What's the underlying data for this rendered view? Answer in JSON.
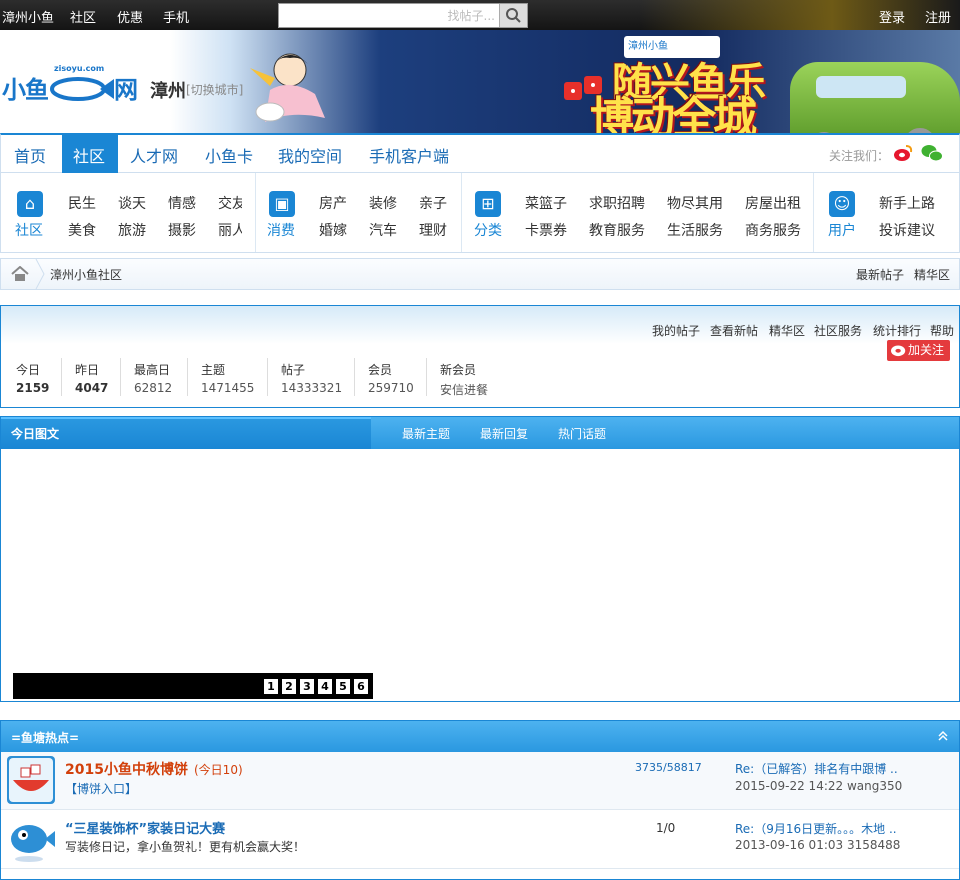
{
  "topbar": {
    "links": [
      "漳州小鱼",
      "社区",
      "优惠",
      "手机"
    ],
    "search_placeholder": "找帖子...",
    "login": "登录",
    "register": "注册"
  },
  "header": {
    "logo_text": "小鱼",
    "logo_suffix": "网",
    "logo_domain": "zisoyu.com",
    "city": "漳州",
    "switch_city": "[切换城市]",
    "promo_line1": "随兴鱼乐",
    "promo_line2": "博动全城",
    "banner_tag": "漳州小鱼"
  },
  "nav": {
    "items": [
      "首页",
      "社区",
      "人才网",
      "小鱼卡",
      "我的空间",
      "手机客户端"
    ],
    "active": "社区",
    "follow_label": "关注我们："
  },
  "categories": {
    "community": {
      "label": "社区",
      "row1": [
        "民生",
        "谈天",
        "情感",
        "交友"
      ],
      "row2": [
        "美食",
        "旅游",
        "摄影",
        "丽人"
      ]
    },
    "consume": {
      "label": "消费",
      "row1": [
        "房产",
        "装修",
        "亲子"
      ],
      "row2": [
        "婚嫁",
        "汽车",
        "理财"
      ]
    },
    "classify": {
      "label": "分类",
      "row1": [
        "菜篮子",
        "求职招聘",
        "物尽其用",
        "房屋出租"
      ],
      "row2": [
        "卡票券",
        "教育服务",
        "生活服务",
        "商务服务"
      ]
    },
    "user": {
      "label": "用户",
      "row1": [
        "新手上路"
      ],
      "row2": [
        "投诉建议"
      ]
    }
  },
  "breadcrumb": {
    "current": "漳州小鱼社区",
    "right_links": [
      "最新帖子",
      "精华区"
    ]
  },
  "stats": {
    "links": [
      "我的帖子",
      "查看新帖",
      "精华区",
      "社区服务",
      "统计排行",
      "帮助"
    ],
    "follow_btn": "加关注",
    "items": [
      {
        "label": "今日",
        "value": "2159"
      },
      {
        "label": "昨日",
        "value": "4047"
      },
      {
        "label": "最高日",
        "value": "62812"
      },
      {
        "label": "主题",
        "value": "1471455"
      },
      {
        "label": "帖子",
        "value": "14333321"
      },
      {
        "label": "会员",
        "value": "259710"
      },
      {
        "label": "新会员",
        "value": "安信进餐"
      }
    ]
  },
  "today_panel": {
    "title": "今日图文",
    "tabs": [
      "最新主题",
      "最新回复",
      "热门话题"
    ],
    "slides": [
      "1",
      "2",
      "3",
      "4",
      "5",
      "6"
    ]
  },
  "hot_panel": {
    "title": "=鱼塘热点=",
    "rows": [
      {
        "title": "2015小鱼中秋博饼",
        "today": "(今日10)",
        "sub": "【博饼入口】",
        "counts": "3735/58817",
        "last_title": "Re:（已解答）排名有中跟博 ..",
        "last_time": "2015-09-22 14:22 wang350"
      },
      {
        "title": "“三星装饰杯”家装日记大赛",
        "today": "",
        "sub": "写装修日记，拿小鱼贺礼！更有机会赢大奖！",
        "counts": "1/0",
        "last_title": "Re:（9月16日更新。。。木地 ..",
        "last_time": "2013-09-16 01:03 3158488"
      }
    ]
  },
  "colors": {
    "accent": "#1a86d4",
    "hot_title": "#d2400b",
    "topbar": "#1f1f1f"
  }
}
